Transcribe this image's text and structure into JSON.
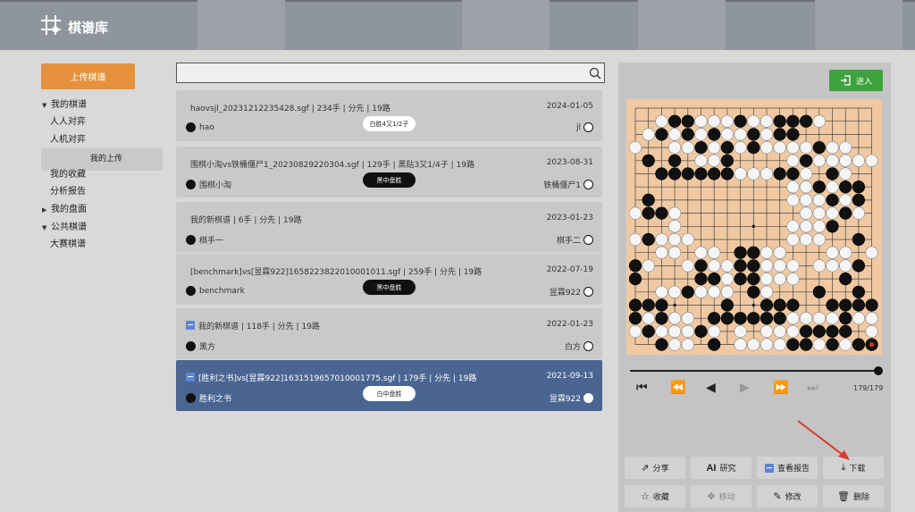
{
  "header": {
    "title": "棋谱库"
  },
  "upload_label": "上传棋谱",
  "tree": {
    "my_games": "我的棋谱",
    "items": [
      "人人对弈",
      "人机对弈",
      "我的上传",
      "我的收藏",
      "分析报告"
    ],
    "my_boards": "我的盘面",
    "public": "公共棋谱",
    "public_items": [
      "大赛棋谱"
    ]
  },
  "search": {
    "placeholder": ""
  },
  "games": [
    {
      "title": "haovsjl_20231212235428.sgf | 234手 | 分先 | 19路",
      "date": "2024-01-05",
      "black": "hao",
      "white": "jl",
      "result": "白胜4又1/2子"
    },
    {
      "title": "围棋小淘vs铁桶僵尸1_20230829220304.sgf | 129手 | 黑贴3又1/4子 | 19路",
      "date": "2023-08-31",
      "black": "围棋小淘",
      "white": "铁桶僵尸1",
      "result": "黑中盘胜"
    },
    {
      "title": "我的新棋谱 | 6手 | 分先 | 19路",
      "date": "2023-01-23",
      "black": "棋手一",
      "white": "棋手二",
      "result": ""
    },
    {
      "title": "[benchmark]vs[昱霖922]1658223822010001011.sgf | 259手 | 分先 | 19路",
      "date": "2022-07-19",
      "black": "benchmark",
      "white": "昱霖922",
      "result": "黑中盘胜"
    },
    {
      "title": "我的新棋谱 | 118手 | 分先 | 19路",
      "date": "2022-01-23",
      "black": "黑方",
      "white": "白方",
      "result": ""
    },
    {
      "title": "[胜利之书]vs[昱霖922]1631519657010001775.sgf | 179手 | 分先 | 19路",
      "date": "2021-09-13",
      "black": "胜利之书",
      "white": "昱霖922",
      "result": "白中盘胜"
    }
  ],
  "enter_label": "进入",
  "move_counter": "179/179",
  "actions": [
    "分享",
    "研究",
    "查看报告",
    "下载",
    "收藏",
    "移动",
    "修改",
    "删除"
  ],
  "action_ai": "AI",
  "icons": [
    "grid-logo-icon",
    "search-icon",
    "login-icon",
    "first-icon",
    "rewind-icon",
    "prev-icon",
    "next-icon",
    "fastforward-icon",
    "last-icon",
    "share-icon",
    "report-icon",
    "download-icon",
    "star-icon",
    "move-icon",
    "edit-icon",
    "trash-icon"
  ],
  "board": {
    "size": 19,
    "black": [
      [
        3,
        1
      ],
      [
        4,
        1
      ],
      [
        8,
        1
      ],
      [
        11,
        1
      ],
      [
        12,
        1
      ],
      [
        13,
        1
      ],
      [
        2,
        2
      ],
      [
        4,
        2
      ],
      [
        6,
        2
      ],
      [
        9,
        2
      ],
      [
        11,
        2
      ],
      [
        12,
        2
      ],
      [
        5,
        3
      ],
      [
        7,
        3
      ],
      [
        9,
        3
      ],
      [
        14,
        3
      ],
      [
        1,
        4
      ],
      [
        3,
        4
      ],
      [
        7,
        4
      ],
      [
        13,
        4
      ],
      [
        2,
        5
      ],
      [
        3,
        5
      ],
      [
        4,
        5
      ],
      [
        5,
        5
      ],
      [
        6,
        5
      ],
      [
        7,
        5
      ],
      [
        11,
        5
      ],
      [
        12,
        5
      ],
      [
        15,
        5
      ],
      [
        14,
        6
      ],
      [
        16,
        6
      ],
      [
        17,
        6
      ],
      [
        1,
        7
      ],
      [
        15,
        7
      ],
      [
        17,
        7
      ],
      [
        1,
        8
      ],
      [
        2,
        8
      ],
      [
        16,
        8
      ],
      [
        15,
        9
      ],
      [
        1,
        10
      ],
      [
        17,
        10
      ],
      [
        8,
        11
      ],
      [
        9,
        11
      ],
      [
        0,
        12
      ],
      [
        5,
        12
      ],
      [
        8,
        12
      ],
      [
        9,
        12
      ],
      [
        17,
        12
      ],
      [
        0,
        13
      ],
      [
        5,
        13
      ],
      [
        6,
        13
      ],
      [
        8,
        13
      ],
      [
        9,
        13
      ],
      [
        16,
        13
      ],
      [
        4,
        14
      ],
      [
        9,
        14
      ],
      [
        14,
        14
      ],
      [
        17,
        14
      ],
      [
        0,
        15
      ],
      [
        1,
        15
      ],
      [
        2,
        15
      ],
      [
        7,
        15
      ],
      [
        10,
        15
      ],
      [
        11,
        15
      ],
      [
        12,
        15
      ],
      [
        15,
        15
      ],
      [
        16,
        15
      ],
      [
        17,
        15
      ],
      [
        18,
        15
      ],
      [
        0,
        16
      ],
      [
        2,
        16
      ],
      [
        6,
        16
      ],
      [
        7,
        16
      ],
      [
        8,
        16
      ],
      [
        9,
        16
      ],
      [
        16,
        16
      ],
      [
        1,
        17
      ],
      [
        5,
        17
      ],
      [
        13,
        17
      ],
      [
        14,
        17
      ],
      [
        15,
        17
      ],
      [
        16,
        17
      ],
      [
        2,
        18
      ],
      [
        6,
        18
      ],
      [
        13,
        18
      ],
      [
        15,
        18
      ],
      [
        17,
        18
      ],
      [
        18,
        18
      ],
      [
        12,
        18
      ],
      [
        10,
        16
      ],
      [
        11,
        16
      ]
    ],
    "white": [
      [
        2,
        1
      ],
      [
        5,
        1
      ],
      [
        6,
        1
      ],
      [
        7,
        1
      ],
      [
        9,
        1
      ],
      [
        10,
        1
      ],
      [
        14,
        1
      ],
      [
        3,
        2
      ],
      [
        5,
        2
      ],
      [
        7,
        2
      ],
      [
        8,
        2
      ],
      [
        10,
        2
      ],
      [
        1,
        2
      ],
      [
        0,
        3
      ],
      [
        3,
        3
      ],
      [
        4,
        3
      ],
      [
        6,
        3
      ],
      [
        8,
        3
      ],
      [
        10,
        3
      ],
      [
        11,
        3
      ],
      [
        12,
        3
      ],
      [
        13,
        3
      ],
      [
        15,
        3
      ],
      [
        16,
        3
      ],
      [
        5,
        4
      ],
      [
        6,
        4
      ],
      [
        12,
        4
      ],
      [
        14,
        4
      ],
      [
        15,
        4
      ],
      [
        16,
        4
      ],
      [
        17,
        4
      ],
      [
        18,
        4
      ],
      [
        8,
        5
      ],
      [
        9,
        5
      ],
      [
        10,
        5
      ],
      [
        13,
        5
      ],
      [
        16,
        5
      ],
      [
        12,
        6
      ],
      [
        13,
        6
      ],
      [
        15,
        6
      ],
      [
        12,
        7
      ],
      [
        13,
        7
      ],
      [
        14,
        7
      ],
      [
        16,
        7
      ],
      [
        0,
        8
      ],
      [
        3,
        8
      ],
      [
        13,
        8
      ],
      [
        14,
        8
      ],
      [
        15,
        8
      ],
      [
        17,
        8
      ],
      [
        3,
        9
      ],
      [
        12,
        9
      ],
      [
        13,
        9
      ],
      [
        14,
        9
      ],
      [
        0,
        10
      ],
      [
        2,
        10
      ],
      [
        3,
        10
      ],
      [
        4,
        10
      ],
      [
        12,
        10
      ],
      [
        13,
        10
      ],
      [
        14,
        10
      ],
      [
        2,
        11
      ],
      [
        3,
        11
      ],
      [
        5,
        11
      ],
      [
        6,
        11
      ],
      [
        10,
        11
      ],
      [
        11,
        11
      ],
      [
        15,
        11
      ],
      [
        16,
        11
      ],
      [
        18,
        11
      ],
      [
        1,
        12
      ],
      [
        4,
        12
      ],
      [
        6,
        12
      ],
      [
        7,
        12
      ],
      [
        10,
        12
      ],
      [
        11,
        12
      ],
      [
        12,
        12
      ],
      [
        14,
        12
      ],
      [
        15,
        12
      ],
      [
        16,
        12
      ],
      [
        7,
        13
      ],
      [
        10,
        13
      ],
      [
        11,
        13
      ],
      [
        12,
        13
      ],
      [
        2,
        14
      ],
      [
        3,
        14
      ],
      [
        5,
        14
      ],
      [
        6,
        14
      ],
      [
        7,
        14
      ],
      [
        10,
        14
      ],
      [
        1,
        16
      ],
      [
        3,
        16
      ],
      [
        4,
        16
      ],
      [
        12,
        16
      ],
      [
        13,
        16
      ],
      [
        14,
        16
      ],
      [
        15,
        16
      ],
      [
        17,
        16
      ],
      [
        18,
        16
      ],
      [
        0,
        17
      ],
      [
        2,
        17
      ],
      [
        3,
        17
      ],
      [
        4,
        17
      ],
      [
        6,
        17
      ],
      [
        8,
        17
      ],
      [
        10,
        17
      ],
      [
        11,
        17
      ],
      [
        12,
        17
      ],
      [
        18,
        17
      ],
      [
        3,
        18
      ],
      [
        9,
        18
      ],
      [
        10,
        18
      ],
      [
        11,
        18
      ],
      [
        14,
        18
      ],
      [
        16,
        18
      ],
      [
        8,
        18
      ],
      [
        4,
        18
      ]
    ],
    "last_move": [
      18,
      18
    ]
  }
}
